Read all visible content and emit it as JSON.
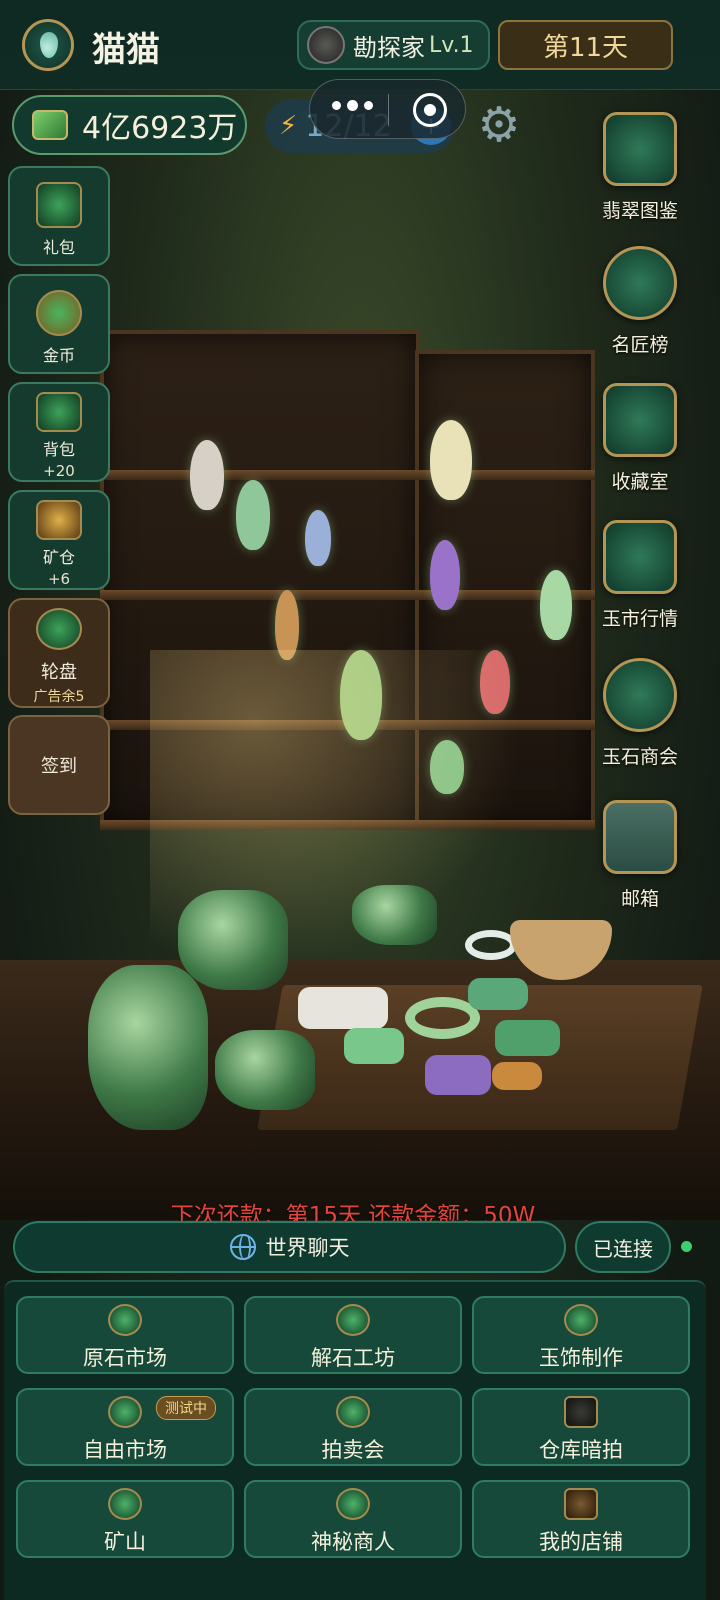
{
  "header": {
    "username": "猫猫",
    "rank": {
      "title": "勘探家",
      "level": "Lv.1"
    },
    "day": "第11天"
  },
  "resources": {
    "coins": "4亿6923万",
    "energy": "12/12",
    "energy_add": "+"
  },
  "left_menu": [
    {
      "label": "礼包",
      "sub": ""
    },
    {
      "label": "金币",
      "sub": ""
    },
    {
      "label": "背包",
      "sub": "+20"
    },
    {
      "label": "矿仓",
      "sub": "+6"
    },
    {
      "label": "轮盘",
      "sub": "广告余5"
    },
    {
      "label": "签到",
      "sub": ""
    }
  ],
  "right_menu": [
    {
      "label": "翡翠图鉴"
    },
    {
      "label": "名匠榜"
    },
    {
      "label": "收藏室"
    },
    {
      "label": "玉市行情"
    },
    {
      "label": "玉石商会"
    },
    {
      "label": "邮箱"
    }
  ],
  "repay_notice": "下次还款：第15天 还款金额：50W",
  "chat": {
    "label": "世界聊天",
    "status": "已连接"
  },
  "grid": [
    {
      "label": "原石市场",
      "badge": ""
    },
    {
      "label": "解石工坊",
      "badge": ""
    },
    {
      "label": "玉饰制作",
      "badge": ""
    },
    {
      "label": "自由市场",
      "badge": "测试中"
    },
    {
      "label": "拍卖会",
      "badge": ""
    },
    {
      "label": "仓库暗拍",
      "badge": ""
    },
    {
      "label": "矿山",
      "badge": ""
    },
    {
      "label": "神秘商人",
      "badge": ""
    },
    {
      "label": "我的店铺",
      "badge": ""
    }
  ],
  "colors": {
    "accent_gold": "#b39654",
    "panel_green": "#16493a",
    "warning_red": "#e2443e",
    "online_green": "#3ccf6b"
  }
}
